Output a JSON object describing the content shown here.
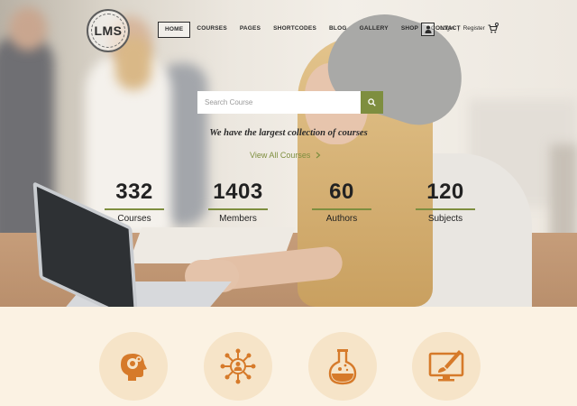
{
  "brand": {
    "logo_text": "LMS"
  },
  "nav": {
    "items": [
      {
        "label": "HOME",
        "active": true
      },
      {
        "label": "COURSES"
      },
      {
        "label": "PAGES"
      },
      {
        "label": "SHORTCODES"
      },
      {
        "label": "BLOG"
      },
      {
        "label": "GALLERY"
      },
      {
        "label": "SHOP"
      },
      {
        "label": "CONTACT"
      }
    ],
    "login_label": "Login",
    "separator": "|",
    "register_label": "Register"
  },
  "search": {
    "placeholder": "Search Course",
    "button_icon": "search-icon"
  },
  "hero": {
    "tagline": "We have the largest collection of courses",
    "view_all_label": "View All Courses",
    "view_all_icon": "chevron-right-icon"
  },
  "stats": [
    {
      "number": "332",
      "label": "Courses"
    },
    {
      "number": "1403",
      "label": "Members"
    },
    {
      "number": "60",
      "label": "Authors"
    },
    {
      "number": "120",
      "label": "Subjects"
    }
  ],
  "features": [
    {
      "icon": "head-gears-icon"
    },
    {
      "icon": "network-user-icon"
    },
    {
      "icon": "flask-icon"
    },
    {
      "icon": "monitor-brush-icon"
    }
  ],
  "colors": {
    "accent_green": "#7e8e3f",
    "icon_orange": "#d67a2a",
    "feature_circle": "#f6e4c8",
    "page_bg": "#fbf2e3"
  }
}
